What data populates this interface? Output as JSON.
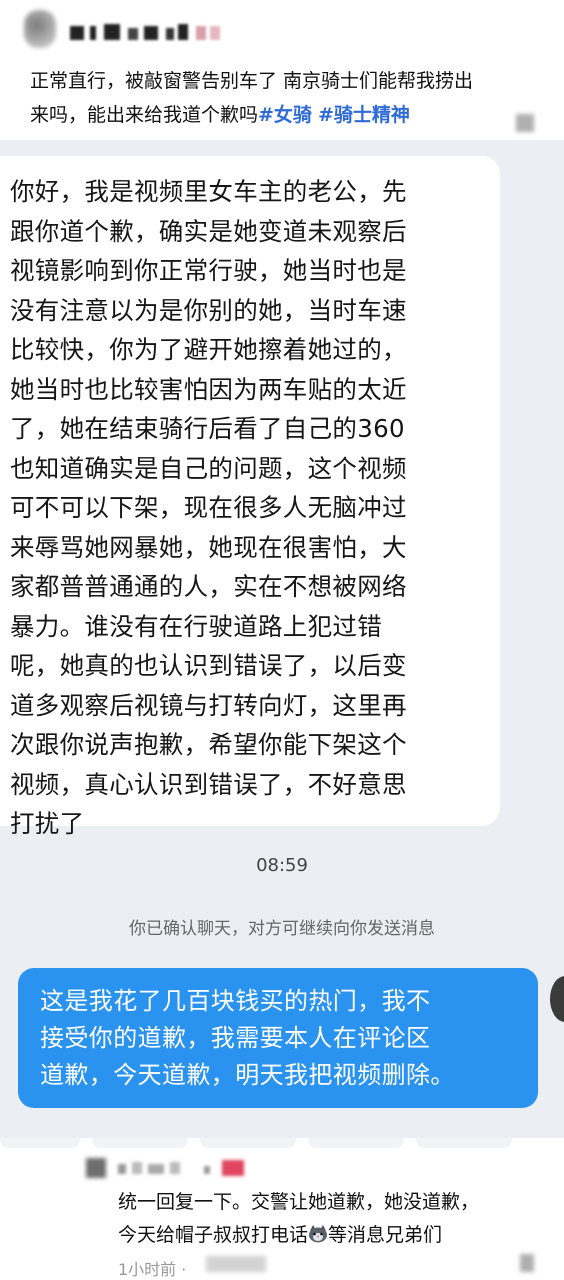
{
  "post": {
    "text_line1": "正常直行，被敲窗警告别车了 南京骑士们能帮我捞出",
    "text_line2": "来吗，能出来给我道个歉吗",
    "tags": [
      "#女骑",
      "#骑士精神"
    ]
  },
  "chat": {
    "incoming_message": "你好，我是视频里女车主的老公，先\n跟你道个歉，确实是她变道未观察后\n视镜影响到你正常行驶，她当时也是\n没有注意以为是你别的她，当时车速\n比较快，你为了避开她擦着她过的，\n她当时也比较害怕因为两车贴的太近\n了，她在结束骑行后看了自己的360\n也知道确实是自己的问题，这个视频\n可不可以下架，现在很多人无脑冲过\n来辱骂她网暴她，她现在很害怕，大\n家都普普通通的人，实在不想被网络\n暴力。谁没有在行驶道路上犯过错\n呢，她真的也认识到错误了，以后变\n道多观察后视镜与打转向灯，这里再\n次跟你说声抱歉，希望你能下架这个\n视频，真心认识到错误了，不好意思\n打扰了",
    "timestamp": "08:59",
    "system_notice": "你已确认聊天，对方可继续向你发送消息",
    "outgoing_message": "这是我花了几百块钱买的热门，我不\n接受你的道歉，我需要本人在评论区\n道歉，今天道歉，明天我把视频删除。",
    "colors": {
      "outgoing_bubble": "#2a93f0",
      "incoming_bubble": "#ffffff",
      "background": "#ebeef3",
      "tag": "#2f6bd6"
    }
  },
  "reply": {
    "text_line1": "统一回复一下。交警让她道歉，她没道歉，",
    "text_line2_before": "今天给帽子叔叔打电话",
    "emoji": "cat-face-icon",
    "text_line2_after": "等消息兄弟们",
    "time": "1小时前 ·"
  }
}
